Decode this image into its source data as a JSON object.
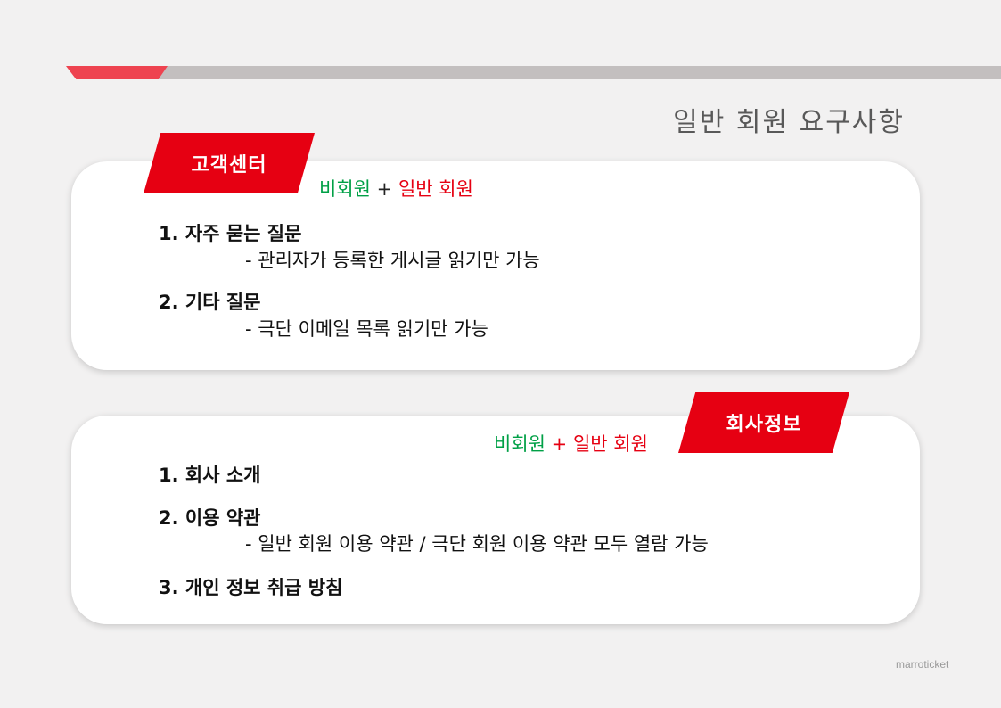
{
  "header": {
    "title": "일반 회원 요구사항"
  },
  "sections": [
    {
      "tag": "고객센터",
      "access": {
        "guest": "비회원",
        "plus": "+",
        "member": "일반 회원"
      },
      "items": [
        {
          "head": "1. 자주 묻는 질문",
          "sub": "- 관리자가 등록한 게시글 읽기만 가능"
        },
        {
          "head": "2. 기타 질문",
          "sub": "- 극단 이메일 목록 읽기만 가능"
        }
      ]
    },
    {
      "tag": "회사정보",
      "access": {
        "guest": "비회원",
        "plus": "+",
        "member": "일반 회원"
      },
      "items": [
        {
          "head": "1. 회사 소개"
        },
        {
          "head": "2. 이용 약관",
          "sub": "- 일반 회원 이용 약관 / 극단 회원 이용 약관 모두 열람 가능"
        },
        {
          "head": "3. 개인 정보 취급 방침"
        }
      ]
    }
  ],
  "footer": {
    "watermark": "marroticket"
  },
  "colors": {
    "accent_red": "#e60012",
    "guest_green": "#00a046",
    "bar_grey": "#c3bfbf"
  }
}
